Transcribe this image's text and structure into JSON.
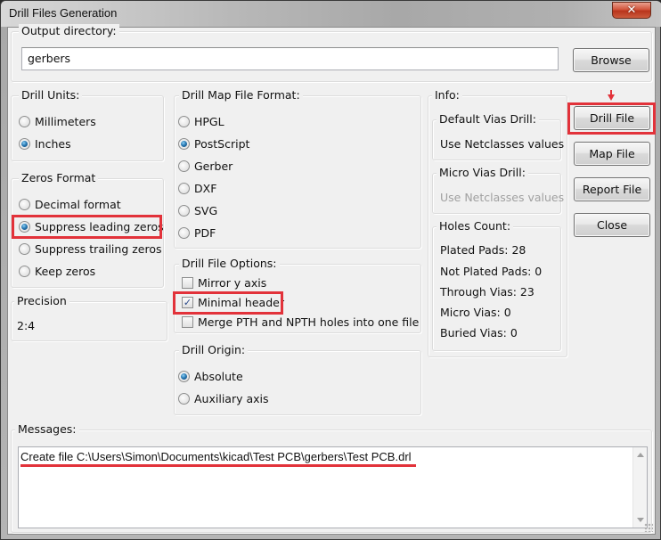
{
  "window": {
    "title": "Drill Files Generation",
    "close_label": "✕"
  },
  "output_directory": {
    "label": "Output directory:",
    "value": "gerbers",
    "browse_label": "Browse"
  },
  "drill_units": {
    "label": "Drill Units:",
    "options": [
      {
        "label": "Millimeters",
        "checked": false
      },
      {
        "label": "Inches",
        "checked": true
      }
    ]
  },
  "zeros_format": {
    "label": "Zeros Format",
    "options": [
      {
        "label": "Decimal format",
        "checked": false
      },
      {
        "label": "Suppress leading zeros",
        "checked": true
      },
      {
        "label": "Suppress trailing zeros",
        "checked": false
      },
      {
        "label": "Keep zeros",
        "checked": false
      }
    ]
  },
  "precision": {
    "label": "Precision",
    "value": "2:4"
  },
  "drill_map_format": {
    "label": "Drill Map File Format:",
    "options": [
      {
        "label": "HPGL",
        "checked": false
      },
      {
        "label": "PostScript",
        "checked": true
      },
      {
        "label": "Gerber",
        "checked": false
      },
      {
        "label": "DXF",
        "checked": false
      },
      {
        "label": "SVG",
        "checked": false
      },
      {
        "label": "PDF",
        "checked": false
      }
    ]
  },
  "drill_file_options": {
    "label": "Drill File Options:",
    "options": [
      {
        "label": "Mirror y axis",
        "checked": false
      },
      {
        "label": "Minimal header",
        "checked": true
      },
      {
        "label": "Merge PTH and NPTH holes into one file",
        "checked": false
      }
    ]
  },
  "drill_origin": {
    "label": "Drill Origin:",
    "options": [
      {
        "label": "Absolute",
        "checked": true
      },
      {
        "label": "Auxiliary axis",
        "checked": false
      }
    ]
  },
  "info": {
    "label": "Info:",
    "default_vias": {
      "label": "Default Vias Drill:",
      "value": "Use Netclasses values"
    },
    "micro_vias": {
      "label": "Micro Vias Drill:",
      "value": "Use Netclasses values"
    },
    "holes_count": {
      "label": "Holes Count:",
      "items": [
        "Plated Pads: 28",
        "Not Plated Pads: 0",
        "Through Vias: 23",
        "Micro Vias: 0",
        "Buried Vias: 0"
      ]
    }
  },
  "buttons": {
    "drill_file": "Drill File",
    "map_file": "Map File",
    "report_file": "Report File",
    "close": "Close"
  },
  "messages": {
    "label": "Messages:",
    "lines": [
      "Create file C:\\Users\\Simon\\Documents\\kicad\\Test PCB\\gerbers\\Test PCB.drl"
    ]
  },
  "annotation_color": "#e2323a"
}
